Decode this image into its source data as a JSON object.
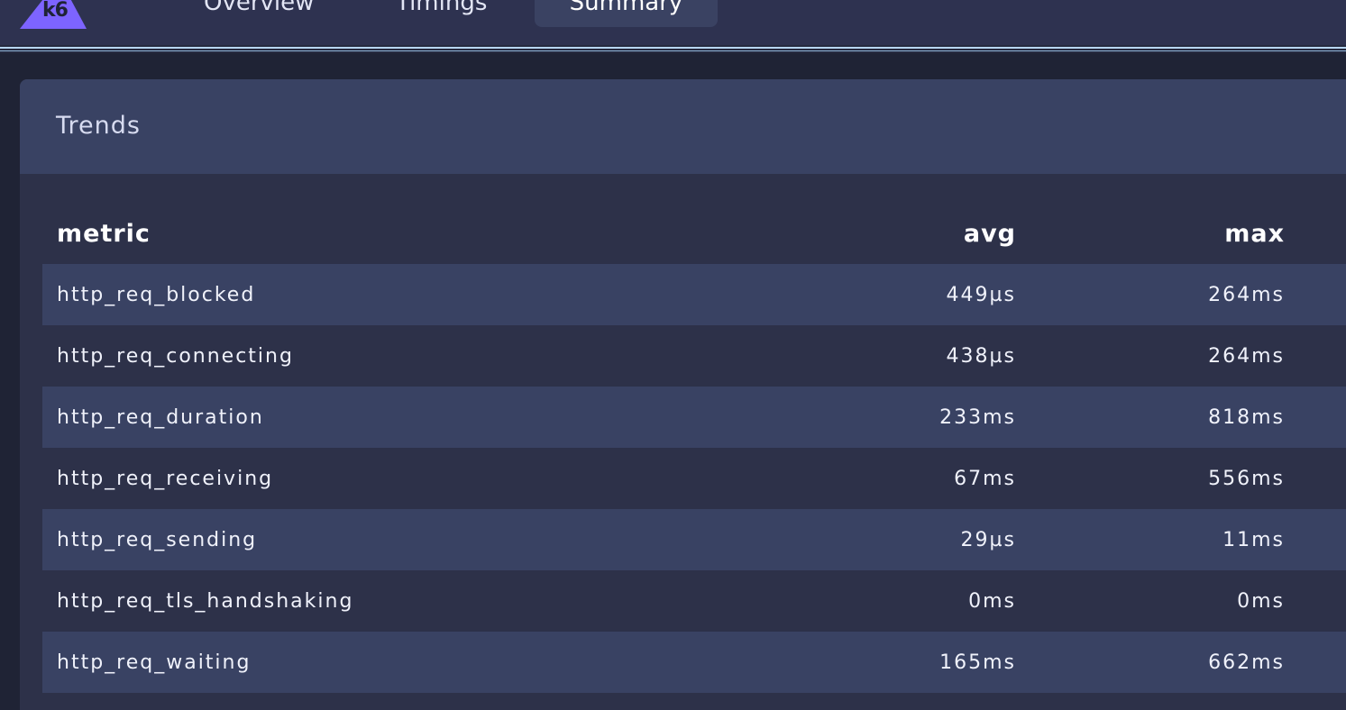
{
  "nav": {
    "logo_text": "k6",
    "tabs": [
      {
        "label": "Overview"
      },
      {
        "label": "Timings"
      },
      {
        "label": "Summary",
        "active": true
      }
    ]
  },
  "colors": {
    "logo": "#7d64ff",
    "background": "#1f2335",
    "card": "#2d3149",
    "row_alt": "#394263"
  },
  "trends": {
    "title": "Trends",
    "headers": {
      "metric": "metric",
      "avg": "avg",
      "max": "max"
    },
    "rows": [
      {
        "metric": "http_req_blocked",
        "avg": "449µs",
        "max": "264ms"
      },
      {
        "metric": "http_req_connecting",
        "avg": "438µs",
        "max": "264ms"
      },
      {
        "metric": "http_req_duration",
        "avg": "233ms",
        "max": "818ms"
      },
      {
        "metric": "http_req_receiving",
        "avg": "67ms",
        "max": "556ms"
      },
      {
        "metric": "http_req_sending",
        "avg": "29µs",
        "max": "11ms"
      },
      {
        "metric": "http_req_tls_handshaking",
        "avg": "0ms",
        "max": "0ms"
      },
      {
        "metric": "http_req_waiting",
        "avg": "165ms",
        "max": "662ms"
      }
    ]
  }
}
